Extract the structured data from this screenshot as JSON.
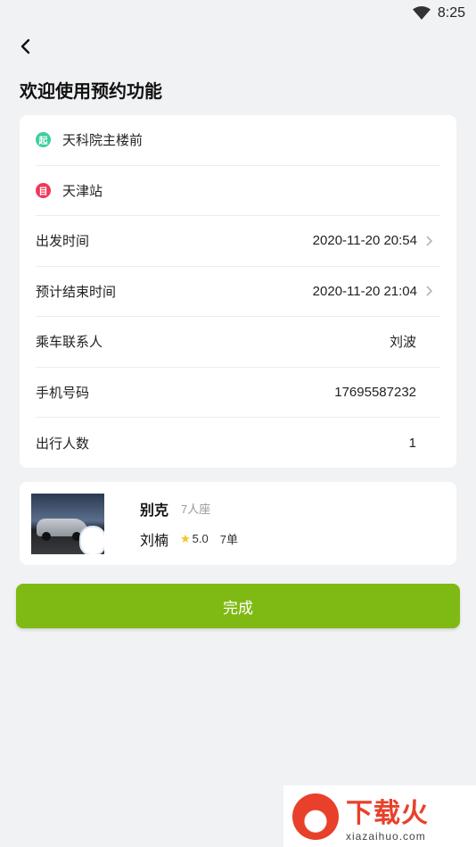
{
  "status_bar": {
    "time": "8:25",
    "icons": [
      "wifi-icon"
    ]
  },
  "header": {
    "back_icon": "chevron-left-icon",
    "title": "欢迎使用预约功能"
  },
  "route": {
    "start": {
      "badge": "起",
      "badge_color": "#3ccf9c",
      "label": "天科院主楼前"
    },
    "end": {
      "badge": "目",
      "badge_color": "#f0395b",
      "label": "天津站"
    }
  },
  "form": {
    "rows": [
      {
        "label": "出发时间",
        "value": "2020-11-20 20:54",
        "has_arrow": true
      },
      {
        "label": "预计结束时间",
        "value": "2020-11-20 21:04",
        "has_arrow": true
      },
      {
        "label": "乘车联系人",
        "value": "刘波",
        "has_arrow": false
      },
      {
        "label": "手机号码",
        "value": "17695587232",
        "has_arrow": false
      },
      {
        "label": "出行人数",
        "value": "1",
        "has_arrow": false
      }
    ]
  },
  "car": {
    "model": "别克",
    "seats": "7人座",
    "driver": "刘楠",
    "rating": "5.0",
    "orders": "7单",
    "star_color": "#f7c325"
  },
  "actions": {
    "done_label": "完成",
    "done_color": "#7fba14"
  },
  "watermark": {
    "title": "下载火",
    "url": "xiazaihuo.com",
    "brand_color": "#e8402a"
  }
}
